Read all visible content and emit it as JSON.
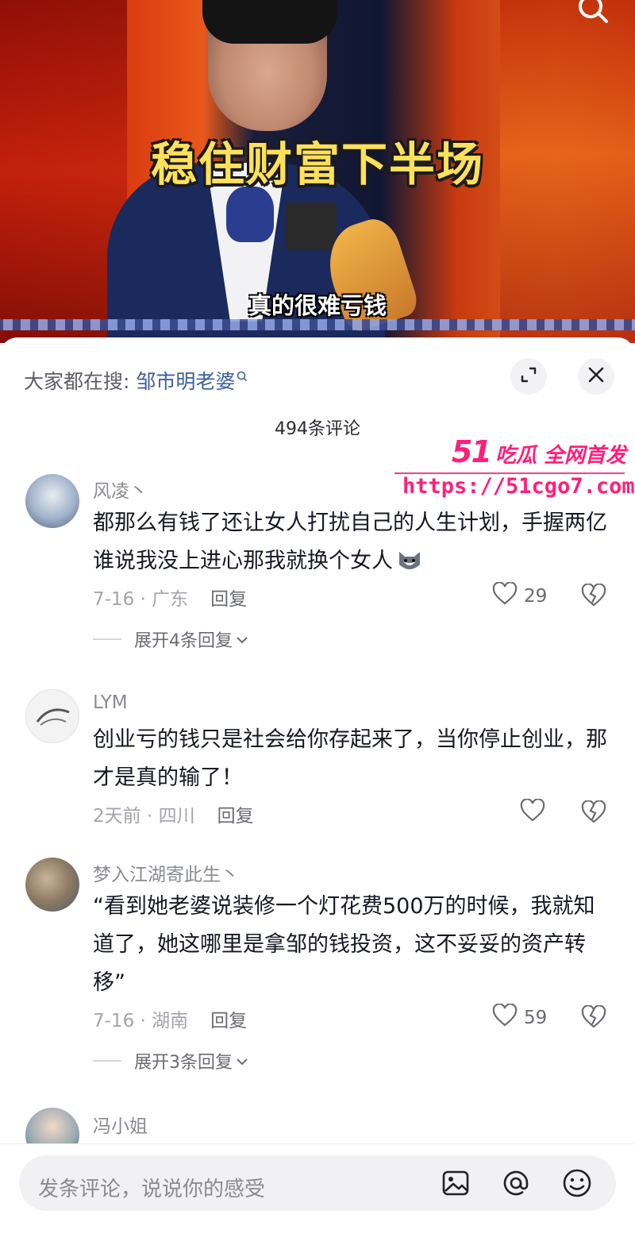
{
  "video": {
    "title_overlay": "稳住财富下半场",
    "subtitle": "真的很难亏钱",
    "search_icon": "search-icon"
  },
  "sheet": {
    "hot_search_prefix": "大家都在搜: ",
    "hot_search_term": "邹市明老婆",
    "comment_count": "494条评论",
    "expand_icon": "expand-icon",
    "close_icon": "close-icon"
  },
  "watermark": {
    "brand_num": "51",
    "brand_text": "吃瓜 全网首发",
    "url": "https://51cgo7.com"
  },
  "comments": [
    {
      "name": "风凌丶",
      "text": "都那么有钱了还让女人打扰自己的人生计划，手握两亿谁说我没上进心那我就换个女人",
      "date_location": "7-16 · 广东",
      "reply_label": "回复",
      "likes": "29",
      "expand_replies": "展开4条回复"
    },
    {
      "name": "LYM",
      "text": "创业亏的钱只是社会给你存起来了，当你停止创业，那才是真的输了！",
      "date_location": "2天前 · 四川",
      "reply_label": "回复",
      "likes": ""
    },
    {
      "name": "梦入江湖寄此生丶",
      "text": "“看到她老婆说装修一个灯花费500万的时候，我就知道了，她这哪里是拿邹的钱投资，这不妥妥的资产转移”",
      "date_location": "7-16 · 湖南",
      "reply_label": "回复",
      "likes": "59",
      "expand_replies": "展开3条回复"
    },
    {
      "name": "冯小姐"
    }
  ],
  "input_bar": {
    "placeholder": "发条评论，说说你的感受",
    "icons": [
      "image-icon",
      "at-icon",
      "emoji-icon"
    ]
  },
  "colors": {
    "link": "#3e5fa0",
    "watermark": "#ff1f7a",
    "title_yellow": "#fde15a"
  }
}
